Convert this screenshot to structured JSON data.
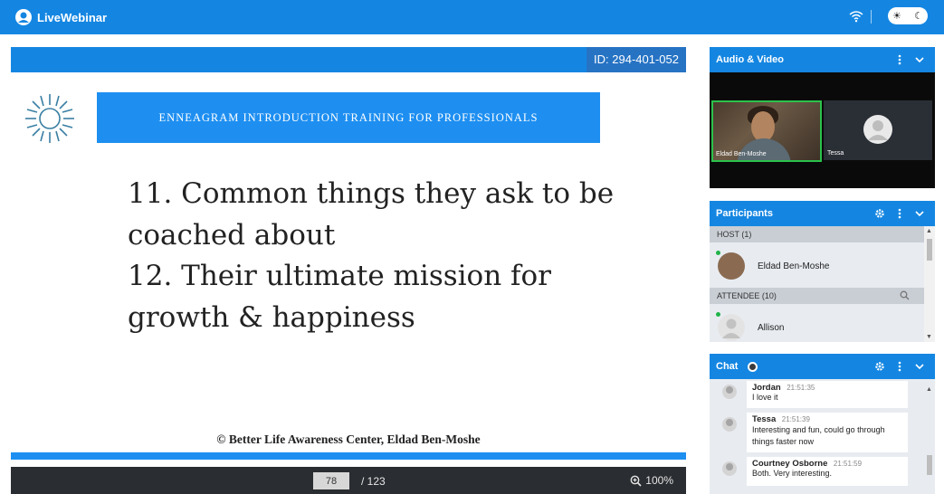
{
  "app": {
    "name": "LiveWebinar"
  },
  "topbar": {
    "theme_light": "☀",
    "theme_dark": "☾"
  },
  "presentation": {
    "id_label": "ID: 294-401-052",
    "slide": {
      "banner": "ENNEAGRAM INTRODUCTION TRAINING FOR PROFESSIONALS",
      "lines": [
        "11. Common things they ask to be",
        "coached about",
        "12. Their ultimate mission for",
        "growth & happiness"
      ],
      "footer": "© Better Life Awareness Center, Eldad Ben-Moshe"
    },
    "toolbar": {
      "current_page": "78",
      "total_pages": "/ 123",
      "zoom": "100%"
    }
  },
  "audio_video": {
    "title": "Audio & Video",
    "tiles": [
      {
        "name": "Eldad Ben-Moshe"
      },
      {
        "name": "Tessa"
      }
    ]
  },
  "participants": {
    "title": "Participants",
    "host_label": "HOST",
    "host_count": "(1)",
    "host": {
      "name": "Eldad Ben-Moshe"
    },
    "attendee_label": "ATTENDEE",
    "attendee_count": "(10)",
    "attendees": [
      {
        "name": "Allison"
      }
    ]
  },
  "chat": {
    "title": "Chat",
    "messages": [
      {
        "author": "Jordan",
        "time": "21:51:35",
        "text": "I love it"
      },
      {
        "author": "Tessa",
        "time": "21:51:39",
        "text": "Interesting and fun, could go through things faster now"
      },
      {
        "author": "Courtney Osborne",
        "time": "21:51:59",
        "text": "Both.  Very interesting."
      }
    ]
  },
  "colors": {
    "brand": "#1486e2",
    "toolbar": "#2a2d31",
    "online": "#21b34a"
  }
}
